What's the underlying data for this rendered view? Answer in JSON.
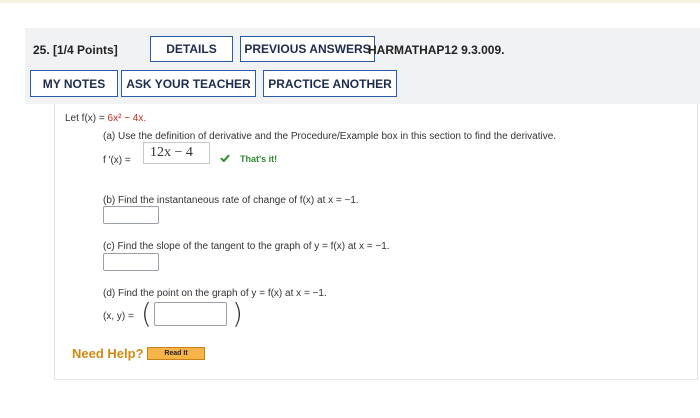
{
  "question": {
    "number_points": "25. [1/4 Points]",
    "buttons": {
      "details": "DETAILS",
      "previous_answers": "PREVIOUS ANSWERS",
      "my_notes": "MY NOTES",
      "ask_teacher": "ASK YOUR TEACHER",
      "practice_another": "PRACTICE ANOTHER"
    },
    "assignment_code": "HARMATHAP12 9.3.009."
  },
  "problem": {
    "intro_prefix": "Let f(x) = ",
    "intro_function": "6x² − 4x.",
    "part_a": {
      "prompt": "(a) Use the definition of derivative and the Procedure/Example box in this section to find the derivative.",
      "label": "f '(x) =",
      "answer": "12x − 4",
      "feedback": "That's it!"
    },
    "part_b": {
      "prompt": "(b) Find the instantaneous rate of change of f(x) at x = −1.",
      "value": ""
    },
    "part_c": {
      "prompt": "(c) Find the slope of the tangent to the graph of y = f(x) at x = −1.",
      "value": ""
    },
    "part_d": {
      "prompt": "(d) Find the point on the graph of y = f(x) at x = −1.",
      "label": "(x, y) =",
      "open_paren": "(",
      "close_paren": ")",
      "value": ""
    }
  },
  "help": {
    "need_help": "Need Help?",
    "read_it": "Read It"
  },
  "colors": {
    "accent_border": "#2a5aa8",
    "correct": "#2e8b2e",
    "function_red": "#c42b1c",
    "help_orange": "#d08a10",
    "read_it_bg": "#f6b449"
  },
  "icons": {
    "correct_feedback": "checkmark-icon"
  }
}
